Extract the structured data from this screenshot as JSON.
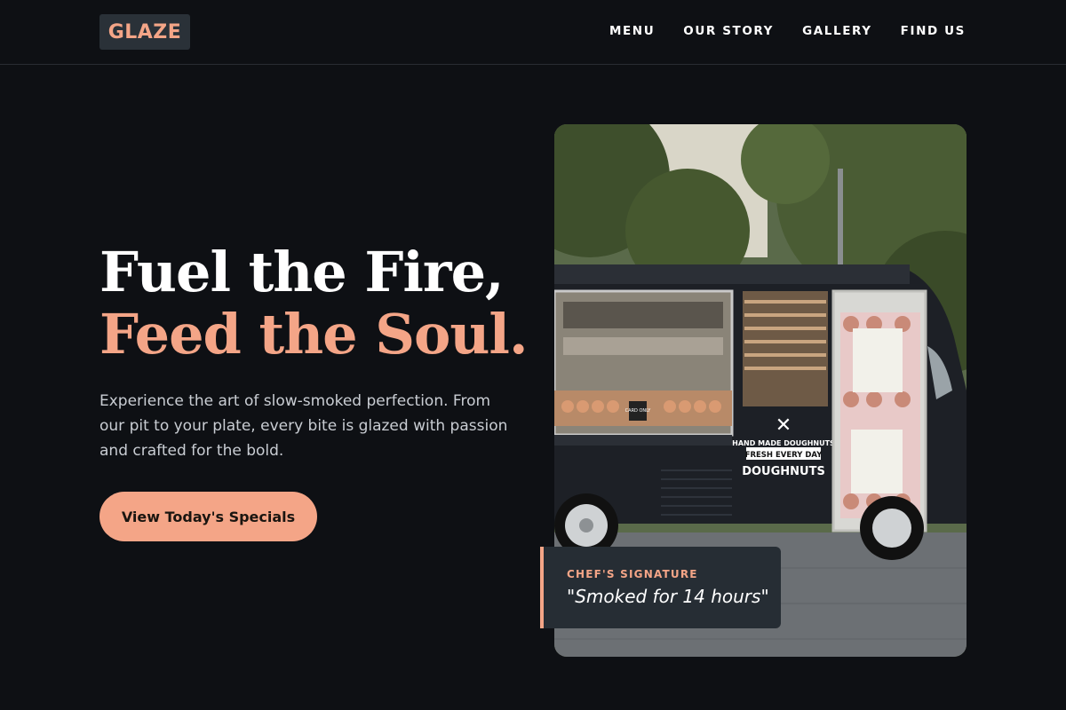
{
  "header": {
    "logo": "GLAZE",
    "nav": [
      "MENU",
      "OUR STORY",
      "GALLERY",
      "FIND US"
    ]
  },
  "hero": {
    "title_line1": "Fuel the Fire,",
    "title_line2": "Feed the Soul.",
    "description": "Experience the art of slow-smoked perfection. From our pit to your plate, every bite is glazed with passion and crafted for the bold.",
    "cta_label": "View Today's Specials"
  },
  "photo": {
    "alt": "Doughnut food truck",
    "truck_signs": {
      "line1": "HAND MADE DOUGHNUTS",
      "line2": "FRESH EVERY DAY",
      "line3": "DOUGHNUTS",
      "card_only": "CARD ONLY"
    }
  },
  "signature": {
    "label": "CHEF'S SIGNATURE",
    "quote": "\"Smoked for 14 hours\""
  },
  "colors": {
    "background": "#0e1014",
    "accent": "#f4a587",
    "card": "#262d34"
  }
}
